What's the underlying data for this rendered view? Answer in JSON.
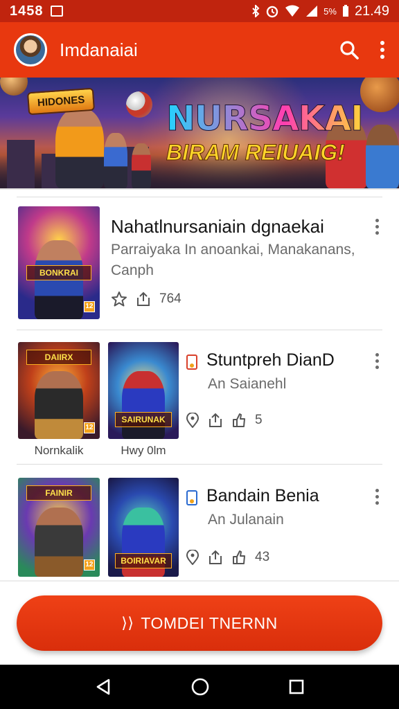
{
  "status_bar": {
    "left_text": "1458",
    "time": "21.49",
    "battery_text": "5%"
  },
  "app_bar": {
    "title": "Imdanaiai"
  },
  "banner": {
    "badge": "HIDONES",
    "headline": "NURSAKAI",
    "subline": "BIRAM REIUAIG!"
  },
  "items": [
    {
      "title": "Nahatlnursaniain dgnaekai",
      "subtitle": "Parraiyaka In anoankai, Manakanans, Canph",
      "count": "764",
      "cover_logo": "BONKRAI"
    },
    {
      "title": "Stuntpreh DianD",
      "subtitle": "An Saianehl",
      "count": "5",
      "covers": [
        {
          "logo": "DAIIRX",
          "caption": "Nornkalik"
        },
        {
          "logo": "SAIRUNAK",
          "caption": "Hwy 0lm"
        }
      ]
    },
    {
      "title": "Bandain Benia",
      "subtitle": "An Julanain",
      "count": "43",
      "covers": [
        {
          "logo": "FAINIR"
        },
        {
          "logo": "BOIRIAVAR"
        }
      ]
    }
  ],
  "cta": {
    "label": "TOMDEI TNERNN"
  },
  "colors": {
    "primary": "#e8380f",
    "status": "#c0240e",
    "nav": "#000000"
  }
}
